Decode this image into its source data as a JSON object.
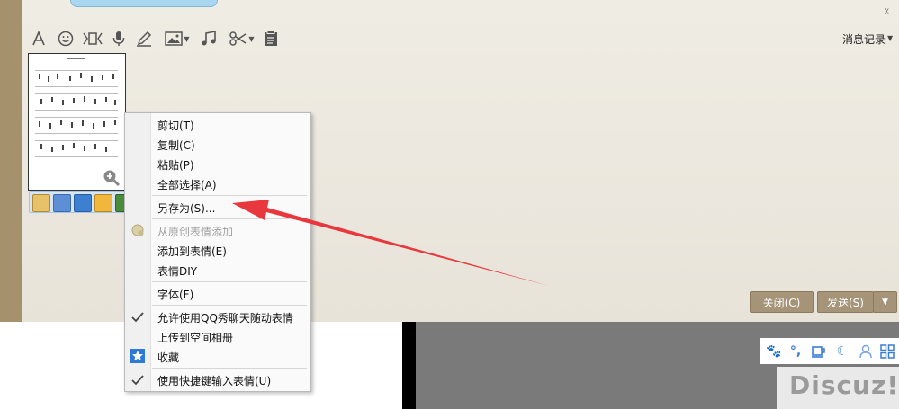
{
  "toolbar": {
    "history_label": "消息记录",
    "icons": [
      "font-icon",
      "smiley-icon",
      "video-icon",
      "mic-icon",
      "pencil-icon",
      "image-icon",
      "music-icon",
      "scissors-icon",
      "clipboard-icon"
    ]
  },
  "buttons": {
    "close_label": "关闭(C)",
    "send_label": "发送(S)"
  },
  "context_menu": {
    "items": [
      {
        "label": "剪切(T)",
        "enabled": true
      },
      {
        "label": "复制(C)",
        "enabled": true
      },
      {
        "label": "粘贴(P)",
        "enabled": true
      },
      {
        "label": "全部选择(A)",
        "enabled": true
      },
      {
        "label": "另存为(S)...",
        "enabled": true
      },
      {
        "label": "从原创表情添加",
        "enabled": false
      },
      {
        "label": "添加到表情(E)",
        "enabled": true
      },
      {
        "label": "表情DIY",
        "enabled": true
      },
      {
        "label": "字体(F)",
        "enabled": true
      },
      {
        "label": "允许使用QQ秀聊天随动表情",
        "enabled": true,
        "checked": true
      },
      {
        "label": "上传到空间相册",
        "enabled": true
      },
      {
        "label": "收藏",
        "enabled": true
      },
      {
        "label": "使用快捷键输入表情(U)",
        "enabled": true,
        "checked": true
      }
    ]
  },
  "watermark": "Discuz!",
  "colors": {
    "accent_button": "#a59478",
    "arrow": "#e8383d",
    "chat_bg": "#ebe7de"
  }
}
